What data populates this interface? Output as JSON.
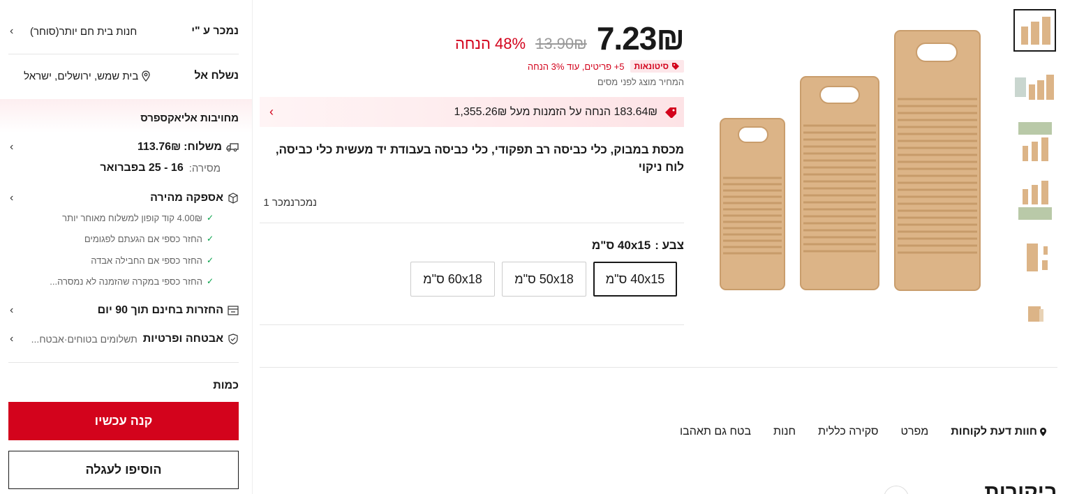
{
  "seller": {
    "label": "נמכר ע \"י",
    "store": "חנות בית חם יותר(סוחר)"
  },
  "ship_to": {
    "label": "נשלח אל",
    "location": "בית שמש, ירושלים, ישראל"
  },
  "commitments": {
    "title": "מחויבות אליאקספרס"
  },
  "shipping": {
    "label": "משלוח:",
    "price": "113.76₪",
    "delivery_label": "מסירה:",
    "delivery_dates": "16 - 25 בפברואר"
  },
  "fast_delivery": {
    "title": "אספקה מהירה",
    "items": [
      "4.00₪ קוד קופון למשלוח מאוחר יותר",
      "החזר כספי אם הגעתם לפגומים",
      "החזר כספי אם החבילה אבדה",
      "החזר כספי במקרה שהזמנה לא נמסרה..."
    ]
  },
  "returns": {
    "title": "החזרות בחינם תוך 90 יום"
  },
  "security": {
    "title": "אבטחה ופרטיות",
    "detail": "תשלומים בטוחים·אבטח..."
  },
  "quantity": {
    "label": "כמות"
  },
  "buttons": {
    "buy_now": "קנה עכשיו",
    "add_to_cart": "הוסיפו לעגלה"
  },
  "price": {
    "current": "7.23₪",
    "original": "13.90₪",
    "discount": "48% הנחה",
    "wholesale_badge": "סיטונאות",
    "wholesale_info": "5+ פריטים, עוד 3% הנחה",
    "tax_note": "המחיר מוצג לפני מסים"
  },
  "coupon": {
    "text": "183.64₪ הנחה על הזמנות מעל 1,355.26₪"
  },
  "product": {
    "title": "מכסת במבוק, כלי כביסה רב תפקודי, כלי כביסה בעבודת יד מעשית כלי כביסה, לוח ניקוי",
    "sold": "נמכרנמכר 1"
  },
  "color": {
    "label": "צבע :",
    "selected": "40x15 ס\"מ",
    "options": [
      "40x15 ס\"מ",
      "50x18 ס\"מ",
      "60x18 ס\"מ"
    ]
  },
  "tabs": [
    "חוות דעת לקוחות",
    "מפרט",
    "סקירה כללית",
    "חנות",
    "בטח גם תאהבו"
  ],
  "reviews_heading": "ביקורות",
  "colors": {
    "accent": "#d3031c",
    "badge_bg": "#fde7ea",
    "wood": "#dcb487",
    "check": "#00a046"
  }
}
